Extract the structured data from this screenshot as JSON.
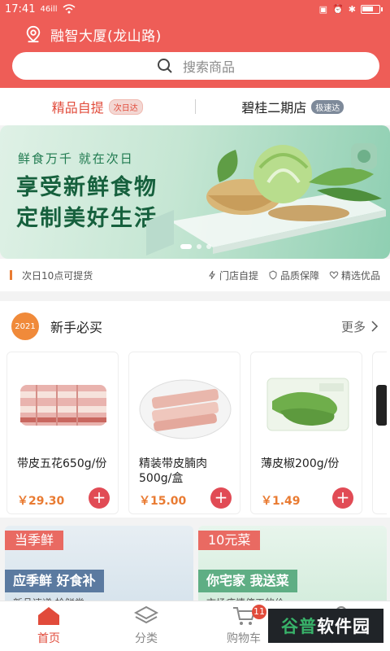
{
  "status": {
    "time": "17:41",
    "signal": "46ill",
    "battery_level": 0.7
  },
  "header": {
    "location": "融智大厦(龙山路)",
    "search_placeholder": "搜索商品"
  },
  "store_tabs": [
    {
      "label": "精品自提",
      "badge": "次日达"
    },
    {
      "label": "碧桂二期店",
      "badge": "极速达"
    }
  ],
  "banner": {
    "small": "鲜食万千 就在次日",
    "line1": "享受新鲜食物",
    "line2": "定制美好生活"
  },
  "service": {
    "left": "次日10点可提货",
    "items": [
      "门店自提",
      "品质保障",
      "精选优品"
    ]
  },
  "new_user": {
    "logo": "2021",
    "title": "新手必买",
    "more": "更多",
    "products": [
      {
        "name": "带皮五花650g/份",
        "price": "￥29.30"
      },
      {
        "name": "精装带皮腩肉500g/盒",
        "price": "￥15.00"
      },
      {
        "name": "薄皮椒200g/份",
        "price": "￥1.49"
      }
    ]
  },
  "promos": [
    {
      "tag": "当季鲜",
      "sub": "应季鲜 好食补",
      "desc": "新品速递 抢鲜尝"
    },
    {
      "tag": "10元菜",
      "sub": "你宅家 我送菜",
      "desc": "市场疫情停工的价"
    }
  ],
  "nav": {
    "items": [
      "首页",
      "分类",
      "购物车",
      "我的"
    ],
    "cart_count": "11"
  },
  "watermark": {
    "part1": "谷普",
    "part2": "软件园"
  },
  "colors": {
    "brand": "#ee5d57",
    "accent": "#e14b3b",
    "price": "#e97b32"
  }
}
